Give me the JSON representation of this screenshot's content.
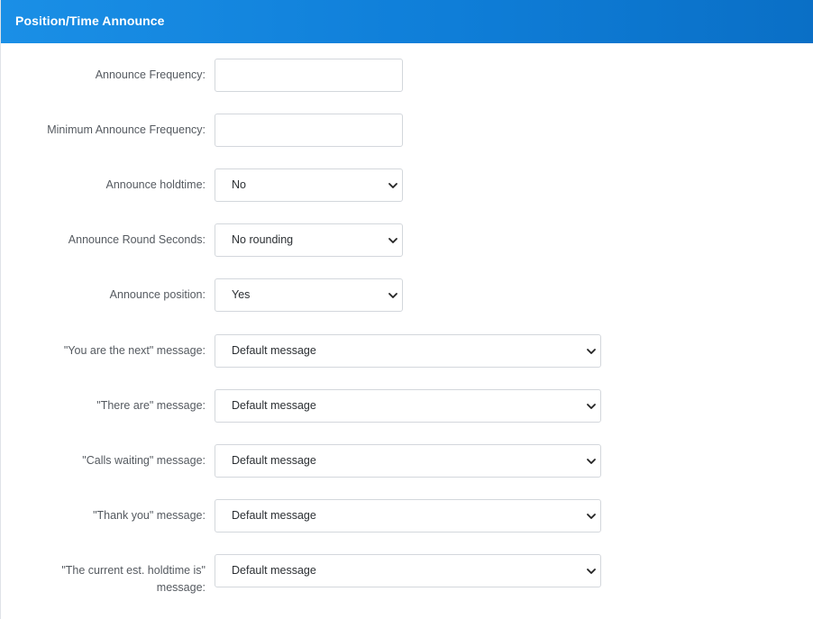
{
  "panel": {
    "title": "Position/Time Announce"
  },
  "fields": {
    "announce_frequency": {
      "label": "Announce Frequency:",
      "value": ""
    },
    "min_announce_frequency": {
      "label": "Minimum Announce Frequency:",
      "value": ""
    },
    "announce_holdtime": {
      "label": "Announce holdtime:",
      "value": "No"
    },
    "announce_round_seconds": {
      "label": "Announce Round Seconds:",
      "value": "No rounding"
    },
    "announce_position": {
      "label": "Announce position:",
      "value": "Yes"
    },
    "you_are_next_msg": {
      "label": "\"You are the next\" message:",
      "value": "Default message"
    },
    "there_are_msg": {
      "label": "\"There are\" message:",
      "value": "Default message"
    },
    "calls_waiting_msg": {
      "label": "\"Calls waiting\" message:",
      "value": "Default message"
    },
    "thank_you_msg": {
      "label": "\"Thank you\" message:",
      "value": "Default message"
    },
    "current_holdtime_msg": {
      "label_line1": "\"The current est. holdtime is\"",
      "label_line2": "message:",
      "value": "Default message"
    }
  },
  "icons": {
    "dropdown": "chevron-down-icon"
  },
  "colors": {
    "header_start": "#1a8fe6",
    "header_end": "#0a6fc6",
    "label_text": "#555a60",
    "field_border": "#d3d7dc"
  }
}
